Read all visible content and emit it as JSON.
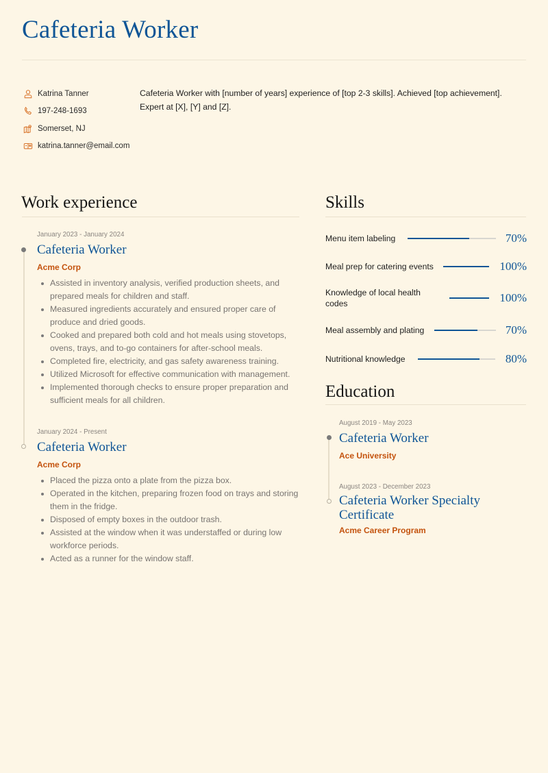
{
  "header": {
    "title": "Cafeteria Worker"
  },
  "contact": {
    "name": "Katrina Tanner",
    "phone": "197-248-1693",
    "location": "Somerset, NJ",
    "email": "katrina.tanner@email.com",
    "icons": [
      "user-icon",
      "phone-icon",
      "map-icon",
      "mail-icon"
    ],
    "icon_color": "#d9772f"
  },
  "summary": "Cafeteria Worker with [number of years] experience of [top 2-3 skills]. Achieved [top achievement]. Expert at [X], [Y] and [Z].",
  "colors": {
    "background": "#fdf6e6",
    "accent_blue": "#0f5596",
    "accent_orange": "#c4530e",
    "muted_text": "#777370"
  },
  "work": {
    "title": "Work experience",
    "entries": [
      {
        "date": "January 2023 - January 2024",
        "role": "Cafeteria Worker",
        "org": "Acme Corp",
        "bullets": [
          "Assisted in inventory analysis, verified production sheets, and prepared meals for children and staff.",
          "Measured ingredients accurately and ensured proper care of produce and dried goods.",
          "Cooked and prepared both cold and hot meals using stovetops, ovens, trays, and to-go containers for after-school meals.",
          "Completed fire, electricity, and gas safety awareness training.",
          "Utilized Microsoft for effective communication with management.",
          "Implemented thorough checks to ensure proper preparation and sufficient meals for all children."
        ]
      },
      {
        "date": "January 2024 - Present",
        "role": "Cafeteria Worker",
        "org": "Acme Corp",
        "bullets": [
          "Placed the pizza onto a plate from the pizza box.",
          "Operated in the kitchen, preparing frozen food on trays and storing them in the fridge.",
          "Disposed of empty boxes in the outdoor trash.",
          "Assisted at the window when it was understaffed or during low workforce periods.",
          "Acted as a runner for the window staff."
        ]
      }
    ]
  },
  "skills": {
    "title": "Skills",
    "items": [
      {
        "name": "Menu item labeling",
        "percent_label": "70%",
        "level": 0.7
      },
      {
        "name": "Meal prep for catering events",
        "percent_label": "100%",
        "level": 1.0
      },
      {
        "name": "Knowledge of local health codes",
        "percent_label": "100%",
        "level": 1.0
      },
      {
        "name": "Meal assembly and plating",
        "percent_label": "70%",
        "level": 0.7
      },
      {
        "name": "Nutritional knowledge",
        "percent_label": "80%",
        "level": 0.8
      }
    ]
  },
  "education": {
    "title": "Education",
    "entries": [
      {
        "date": "August 2019 - May 2023",
        "role": "Cafeteria Worker",
        "org": "Ace University"
      },
      {
        "date": "August 2023 - December 2023",
        "role": "Cafeteria Worker Specialty Certificate",
        "org": "Acme Career Program"
      }
    ]
  }
}
